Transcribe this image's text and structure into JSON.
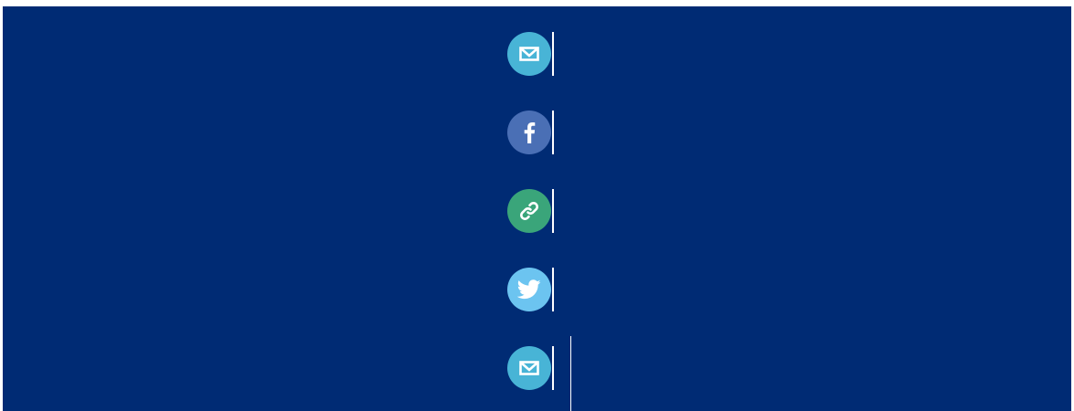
{
  "share_buttons": [
    {
      "network": "email",
      "icon": "mail-icon",
      "color": "#48b4d6"
    },
    {
      "network": "facebook",
      "icon": "facebook-icon",
      "color": "#4a6fb5"
    },
    {
      "network": "copy-link",
      "icon": "link-icon",
      "color": "#3aa57a"
    },
    {
      "network": "twitter",
      "icon": "twitter-icon",
      "color": "#6cc4f0"
    },
    {
      "network": "email",
      "icon": "mail-icon",
      "color": "#48b4d6"
    }
  ],
  "colors": {
    "panel_background": "#002b74",
    "separator": "#ffffff"
  }
}
